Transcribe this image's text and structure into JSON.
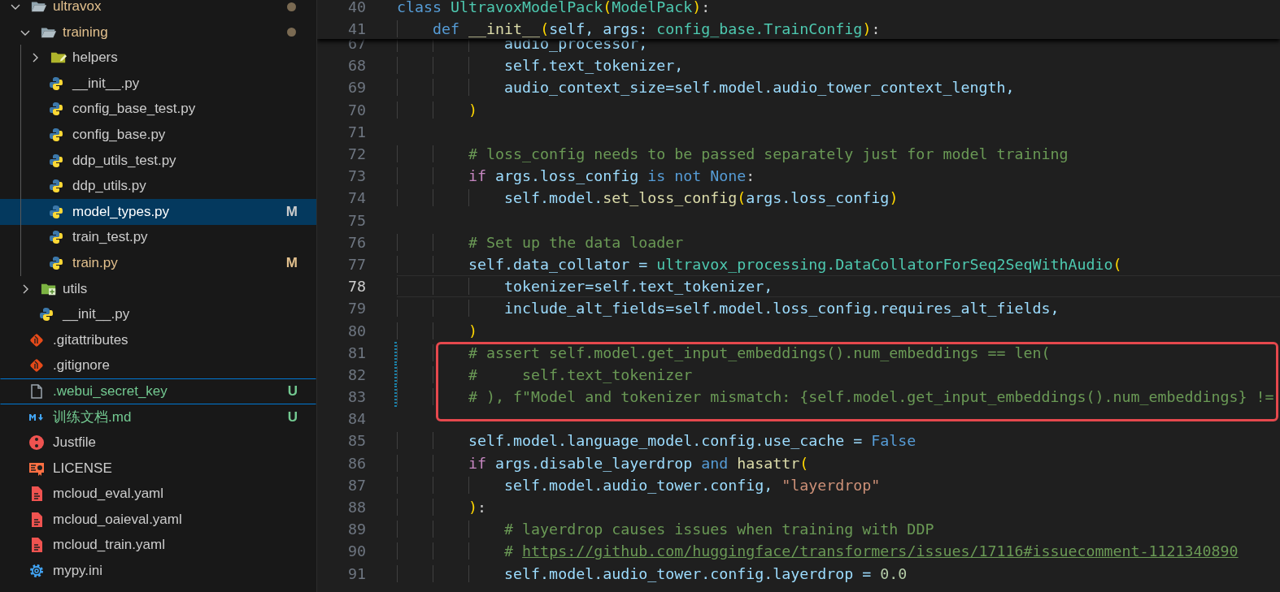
{
  "explorer": {
    "items": [
      {
        "name": "ultravox",
        "kind": "folder",
        "expanded": true,
        "dirty": true,
        "selected": false,
        "focused": false,
        "children": [
          {
            "name": "training",
            "kind": "folder",
            "expanded": true,
            "dirty": true,
            "selected": false,
            "focused": false,
            "children": [
              {
                "name": "helpers",
                "kind": "helper-folder",
                "expanded": false,
                "dirty": false,
                "selected": false,
                "focused": false
              },
              {
                "name": "__init__.py",
                "kind": "python",
                "selected": false,
                "focused": false
              },
              {
                "name": "config_base_test.py",
                "kind": "python",
                "selected": false,
                "focused": false
              },
              {
                "name": "config_base.py",
                "kind": "python",
                "selected": false,
                "focused": false
              },
              {
                "name": "ddp_utils_test.py",
                "kind": "python",
                "selected": false,
                "focused": false
              },
              {
                "name": "ddp_utils.py",
                "kind": "python",
                "selected": false,
                "focused": false
              },
              {
                "name": "model_types.py",
                "kind": "python",
                "selected": true,
                "focused": false,
                "status": "M"
              },
              {
                "name": "train_test.py",
                "kind": "python",
                "selected": false,
                "focused": false
              },
              {
                "name": "train.py",
                "kind": "python",
                "selected": false,
                "focused": false,
                "status": "M"
              }
            ]
          },
          {
            "name": "utils",
            "kind": "utils-folder",
            "expanded": false,
            "dirty": false,
            "selected": false,
            "focused": false
          },
          {
            "name": "__init__.py",
            "kind": "python",
            "selected": false,
            "focused": false
          }
        ]
      },
      {
        "name": ".gitattributes",
        "kind": "git",
        "selected": false,
        "focused": false
      },
      {
        "name": ".gitignore",
        "kind": "git",
        "selected": false,
        "focused": false
      },
      {
        "name": ".webui_secret_key",
        "kind": "plain",
        "selected": false,
        "focused": true,
        "status": "U"
      },
      {
        "name": "训练文档.md",
        "kind": "markdown",
        "selected": false,
        "focused": false,
        "status": "U"
      },
      {
        "name": "Justfile",
        "kind": "justfile",
        "selected": false,
        "focused": false
      },
      {
        "name": "LICENSE",
        "kind": "license",
        "selected": false,
        "focused": false
      },
      {
        "name": "mcloud_eval.yaml",
        "kind": "yaml",
        "selected": false,
        "focused": false
      },
      {
        "name": "mcloud_oaieval.yaml",
        "kind": "yaml",
        "selected": false,
        "focused": false
      },
      {
        "name": "mcloud_train.yaml",
        "kind": "yaml",
        "selected": false,
        "focused": false
      },
      {
        "name": "mypy.ini",
        "kind": "settings",
        "selected": false,
        "focused": false
      }
    ]
  },
  "editor": {
    "sticky_lines": [
      {
        "number": "40",
        "tokens": [
          {
            "text": "class ",
            "kind": "kw"
          },
          {
            "text": "UltravoxModelPack",
            "kind": "cls"
          },
          {
            "text": "(",
            "kind": "br"
          },
          {
            "text": "ModelPack",
            "kind": "cls"
          },
          {
            "text": ")",
            "kind": "br"
          },
          {
            "text": ":",
            "kind": "p"
          }
        ]
      },
      {
        "number": "41",
        "tokens": [
          {
            "text": "    def ",
            "kind": "kw"
          },
          {
            "text": "__init__",
            "kind": "fn"
          },
          {
            "text": "(",
            "kind": "br"
          },
          {
            "text": "self, args: ",
            "kind": "var"
          },
          {
            "text": "config_base.TrainConfig",
            "kind": "cls"
          },
          {
            "text": ")",
            "kind": "br"
          },
          {
            "text": ":",
            "kind": "p"
          }
        ]
      }
    ],
    "lines": [
      {
        "number": "67",
        "current": false,
        "modified": false,
        "highlighted": false,
        "tokens": [
          {
            "text": "            audio_processor,",
            "kind": "var"
          }
        ]
      },
      {
        "number": "68",
        "current": false,
        "modified": false,
        "highlighted": false,
        "tokens": [
          {
            "text": "            self.text_tokenizer,",
            "kind": "var"
          }
        ]
      },
      {
        "number": "69",
        "current": false,
        "modified": false,
        "highlighted": false,
        "tokens": [
          {
            "text": "            audio_context_size=self.model.audio_tower_context_length,",
            "kind": "var"
          }
        ]
      },
      {
        "number": "70",
        "current": false,
        "modified": false,
        "highlighted": false,
        "tokens": [
          {
            "text": "        )",
            "kind": "br"
          }
        ]
      },
      {
        "number": "71",
        "current": false,
        "modified": false,
        "highlighted": false
      },
      {
        "number": "72",
        "current": false,
        "modified": false,
        "highlighted": false,
        "tokens": [
          {
            "text": "        # loss_config needs to be passed separately just for model training",
            "kind": "cm"
          }
        ]
      },
      {
        "number": "73",
        "current": false,
        "modified": false,
        "highlighted": false,
        "tokens": [
          {
            "text": "        if",
            "kind": "ctl"
          },
          {
            "text": " args.loss_config ",
            "kind": "var"
          },
          {
            "text": "is not None",
            "kind": "kw"
          },
          {
            "text": ":",
            "kind": "p"
          }
        ]
      },
      {
        "number": "74",
        "current": false,
        "modified": false,
        "highlighted": false,
        "tokens": [
          {
            "text": "            self.model.",
            "kind": "var"
          },
          {
            "text": "set_loss_config",
            "kind": "fn"
          },
          {
            "text": "(",
            "kind": "br"
          },
          {
            "text": "args.loss_config",
            "kind": "var"
          },
          {
            "text": ")",
            "kind": "br"
          }
        ]
      },
      {
        "number": "75",
        "current": false,
        "modified": false,
        "highlighted": false
      },
      {
        "number": "76",
        "current": false,
        "modified": false,
        "highlighted": false,
        "tokens": [
          {
            "text": "        # Set up the data loader",
            "kind": "cm"
          }
        ]
      },
      {
        "number": "77",
        "current": false,
        "modified": false,
        "highlighted": false,
        "tokens": [
          {
            "text": "        self.data_collator = ",
            "kind": "var"
          },
          {
            "text": "ultravox_processing.DataCollatorForSeq2SeqWithAudio",
            "kind": "cls"
          },
          {
            "text": "(",
            "kind": "br"
          }
        ]
      },
      {
        "number": "78",
        "current": true,
        "modified": false,
        "highlighted": false,
        "tokens": [
          {
            "text": "            tokenizer=self.text_tokenizer,",
            "kind": "var"
          }
        ]
      },
      {
        "number": "79",
        "current": false,
        "modified": false,
        "highlighted": false,
        "tokens": [
          {
            "text": "            include_alt_fields=self.model.loss_config.requires_alt_fields,",
            "kind": "var"
          }
        ]
      },
      {
        "number": "80",
        "current": false,
        "modified": false,
        "highlighted": false,
        "tokens": [
          {
            "text": "        )",
            "kind": "br"
          }
        ]
      },
      {
        "number": "81",
        "current": false,
        "modified": true,
        "highlighted": true,
        "tokens": [
          {
            "text": "        # assert self.model.get_input_embeddings().num_embeddings == len(",
            "kind": "cm"
          }
        ]
      },
      {
        "number": "82",
        "current": false,
        "modified": true,
        "highlighted": true,
        "tokens": [
          {
            "text": "        #     self.text_tokenizer",
            "kind": "cm"
          }
        ]
      },
      {
        "number": "83",
        "current": false,
        "modified": true,
        "highlighted": true,
        "tokens": [
          {
            "text": "        # ), f\"Model and tokenizer mismatch: {self.model.get_input_embeddings().num_embeddings} !=",
            "kind": "cm"
          }
        ]
      },
      {
        "number": "84",
        "current": false,
        "modified": false,
        "highlighted": false
      },
      {
        "number": "85",
        "current": false,
        "modified": false,
        "highlighted": false,
        "tokens": [
          {
            "text": "        self.model.language_model.config.use_cache = ",
            "kind": "var"
          },
          {
            "text": "False",
            "kind": "kw"
          }
        ]
      },
      {
        "number": "86",
        "current": false,
        "modified": false,
        "highlighted": false,
        "tokens": [
          {
            "text": "        if",
            "kind": "ctl"
          },
          {
            "text": " args.disable_layerdrop ",
            "kind": "var"
          },
          {
            "text": "and",
            "kind": "kw"
          },
          {
            "text": " hasattr",
            "kind": "fn"
          },
          {
            "text": "(",
            "kind": "br"
          }
        ]
      },
      {
        "number": "87",
        "current": false,
        "modified": false,
        "highlighted": false,
        "tokens": [
          {
            "text": "            self.model.audio_tower.config, ",
            "kind": "var"
          },
          {
            "text": "\"layerdrop\"",
            "kind": "str"
          }
        ]
      },
      {
        "number": "88",
        "current": false,
        "modified": false,
        "highlighted": false,
        "tokens": [
          {
            "text": "        )",
            "kind": "br"
          },
          {
            "text": ":",
            "kind": "p"
          }
        ]
      },
      {
        "number": "89",
        "current": false,
        "modified": false,
        "highlighted": false,
        "tokens": [
          {
            "text": "            # layerdrop causes issues when training with DDP",
            "kind": "cm"
          }
        ]
      },
      {
        "number": "90",
        "current": false,
        "modified": false,
        "highlighted": false,
        "tokens": [
          {
            "text": "            #",
            "kind": "cm"
          },
          {
            "text": "https://github.com/huggingface/transformers/issues/17116#issuecomment-1121340890",
            "kind": "link"
          }
        ]
      },
      {
        "number": "91",
        "current": false,
        "modified": false,
        "highlighted": false,
        "tokens": [
          {
            "text": "            self.model.audio_tower.config.layerdrop = ",
            "kind": "var"
          },
          {
            "text": "0.0",
            "kind": "num"
          }
        ]
      }
    ]
  }
}
